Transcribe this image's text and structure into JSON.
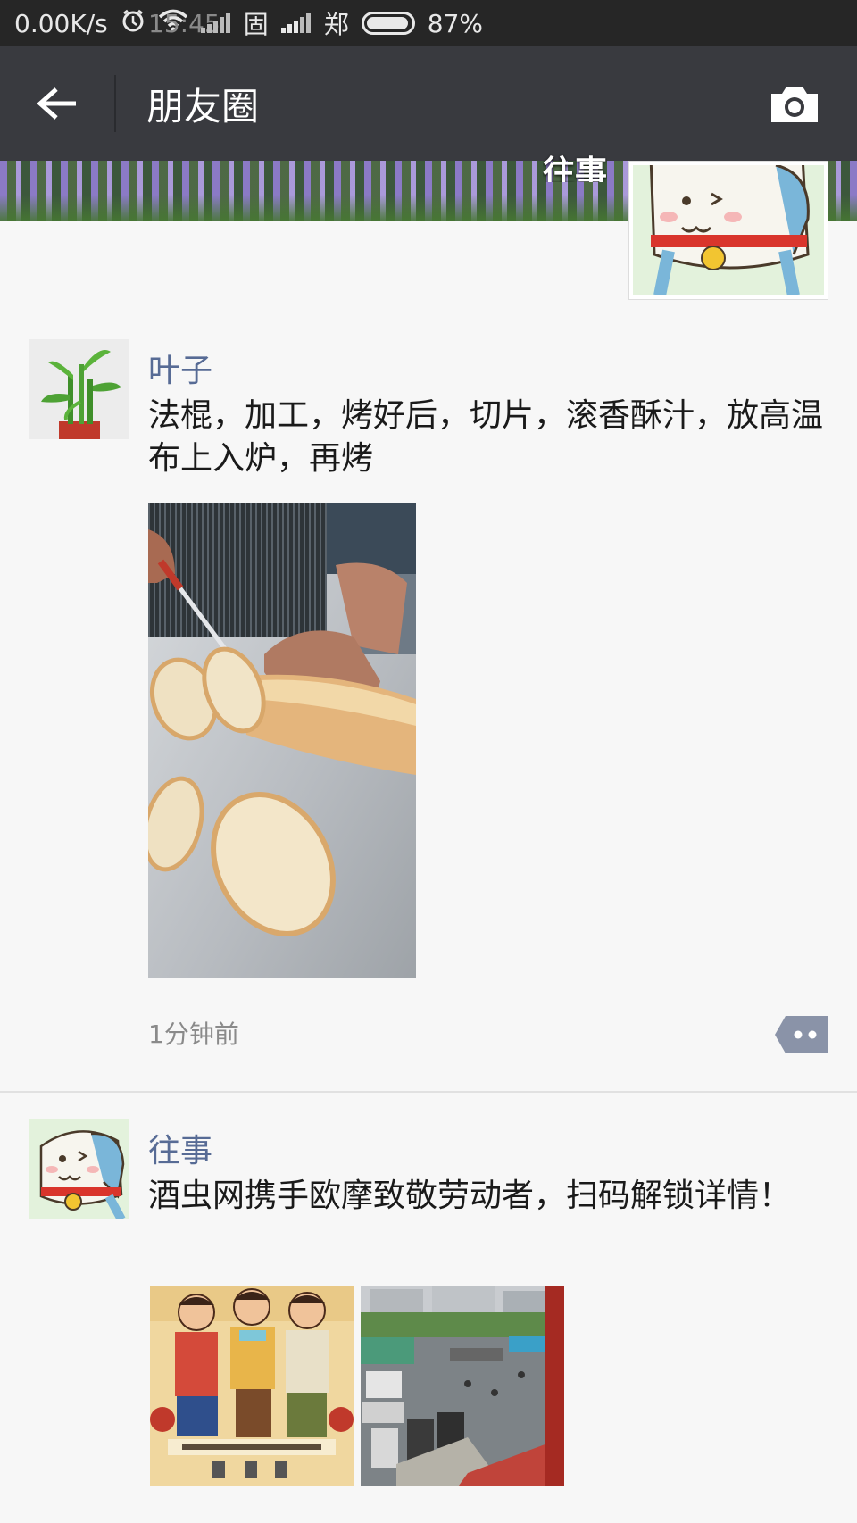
{
  "status_bar": {
    "time": "15:45",
    "network_speed": "0.00K/s",
    "carrier1": "固",
    "carrier2": "郑",
    "battery": "87%",
    "icons": [
      "alarm-icon",
      "wifi-icon",
      "signal-icon",
      "signal-icon",
      "battery-icon"
    ]
  },
  "header": {
    "title": "朋友圈",
    "back_icon": "arrow-left-icon",
    "camera_icon": "camera-icon"
  },
  "cover": {
    "user_name": "往事"
  },
  "posts": [
    {
      "nickname": "叶子",
      "text": "法棍，加工，烤好后，切片，滚香酥汁，放高温布上入炉，再烤",
      "timestamp": "1分钟前",
      "images": [
        "bread-slicing-photo"
      ]
    },
    {
      "nickname": "往事",
      "text": "酒虫网携手欧摩致敬劳动者，扫码解锁详情！",
      "images": [
        "workers-poster-photo",
        "street-parking-photo"
      ]
    }
  ],
  "colors": {
    "nickname": "#576b95",
    "header_bg": "#393a3f",
    "statusbar_bg": "#262626",
    "page_bg": "#f7f7f7"
  }
}
